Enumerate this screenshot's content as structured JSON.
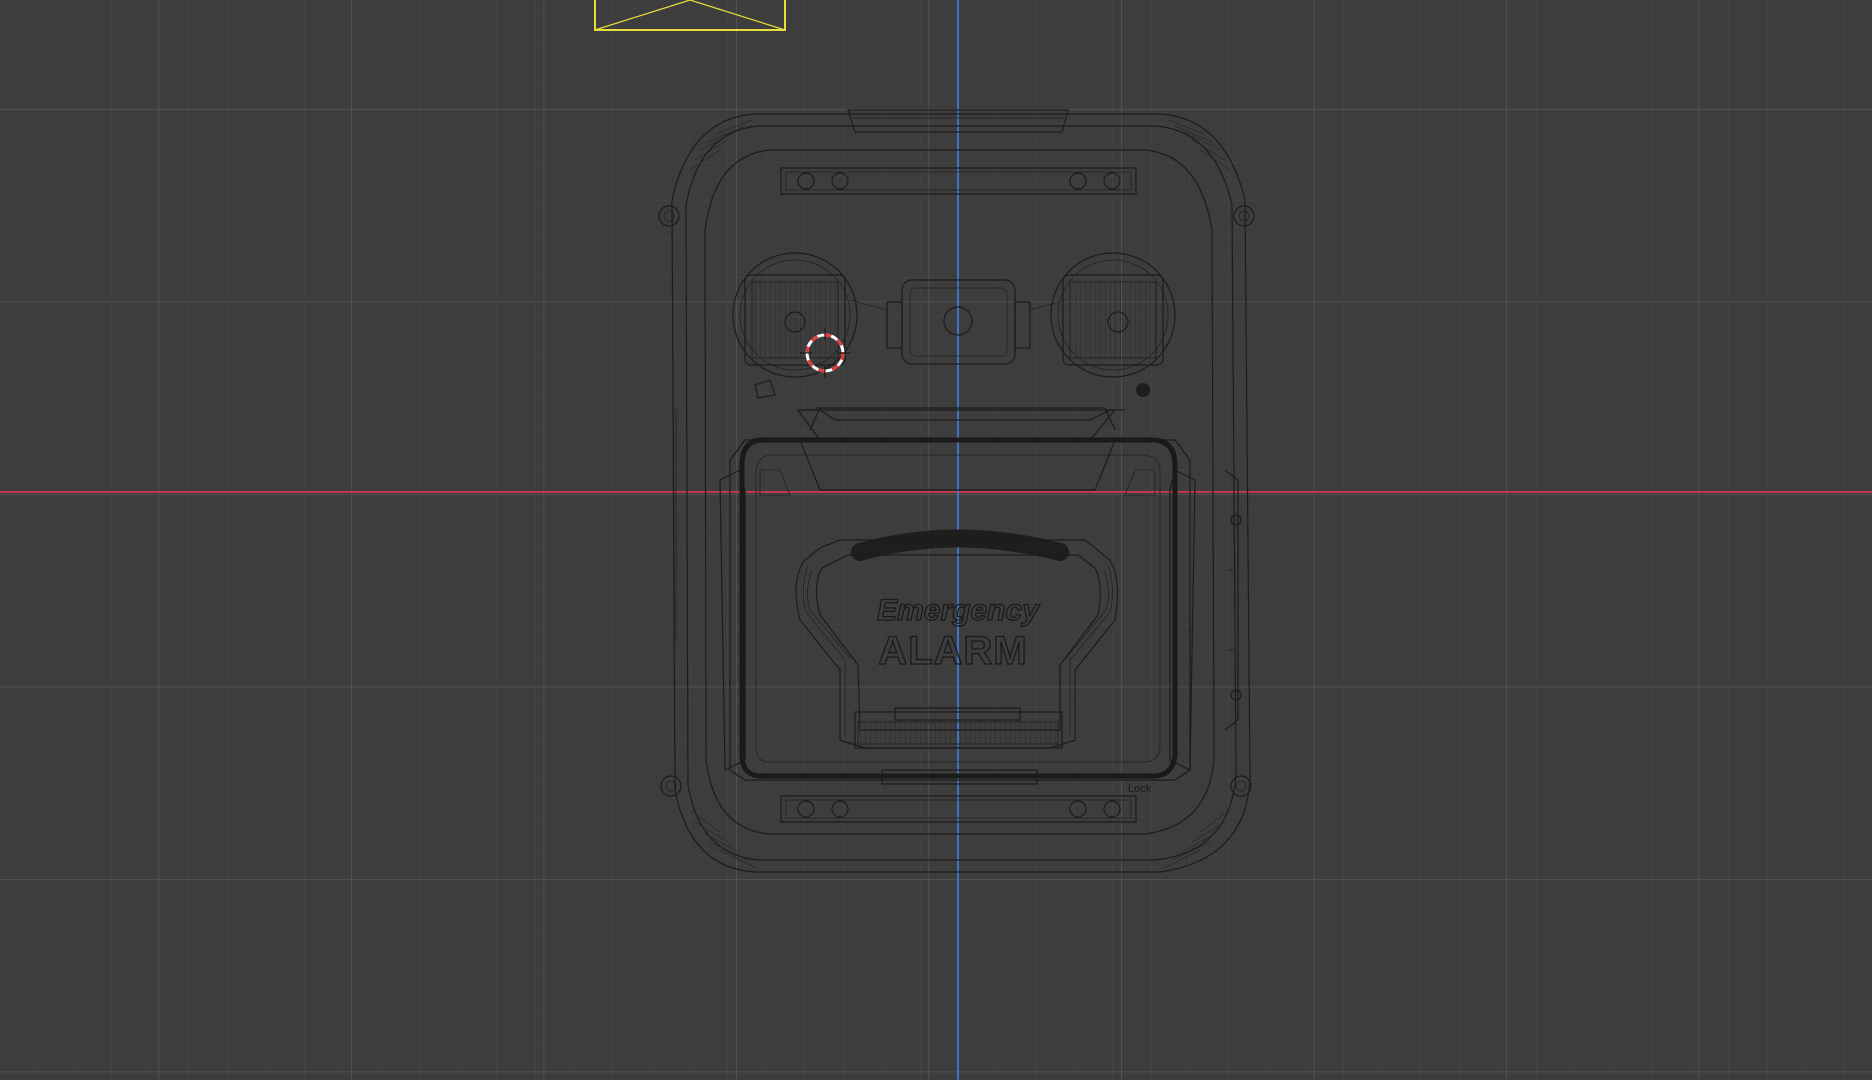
{
  "viewport": {
    "name": "3D viewport - front orthographic wireframe",
    "background": "#3d3d3d",
    "grid_minor_color": "#474747",
    "grid_major_color": "#545454",
    "axis_x_color": "#c0394b",
    "axis_z_color": "#3d74c9",
    "selection_color": "#e8e03a",
    "cursor_color": "#e23b3b"
  },
  "model": {
    "label_line1": "Emergency",
    "label_line2": "ALARM",
    "small_mark": "Lock",
    "wire_color": "#1c1c1c"
  }
}
